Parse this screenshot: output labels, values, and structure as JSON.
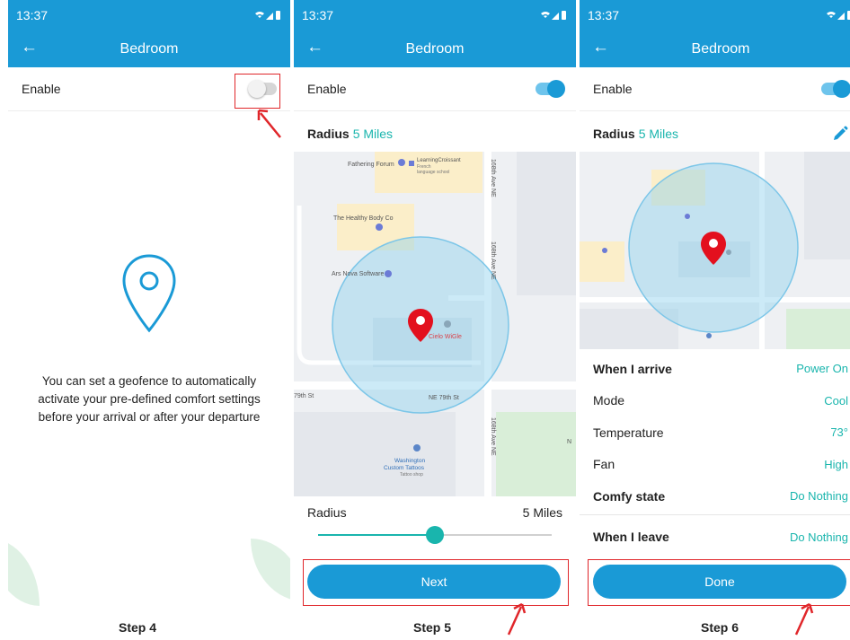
{
  "colors": {
    "primary": "#1a9ad6",
    "accent": "#19b5ad",
    "annotation": "#e0262a",
    "pin": "#e3101e"
  },
  "screens": [
    {
      "status_time": "13:37",
      "title": "Bedroom",
      "enable_label": "Enable",
      "enabled": false,
      "geofence_text": "You can set a geofence to automatically activate your pre-defined comfort settings before your arrival or after your departure",
      "step_label": "Step 4"
    },
    {
      "status_time": "13:37",
      "title": "Bedroom",
      "enable_label": "Enable",
      "enabled": true,
      "radius_label": "Radius",
      "radius_value": "5 Miles",
      "map_labels": {
        "fathering_forum": "Fathering Forum",
        "learning_croissant": "LearningCroissant",
        "learning_croissant_sub": "French",
        "learning_croissant_sub2": "language school",
        "healthy_body": "The Healthy Body Co",
        "ars_nova": "Ars Nova Software",
        "cielo": "Cielo WiGle",
        "street_168": "168th Ave NE",
        "street_79_left": "79th St",
        "street_79": "NE 79th St",
        "washington_tattoos": "Washington",
        "washington_tattoos_2": "Custom Tattoos",
        "washington_tattoos_3": "Tattoo shop",
        "n_label": "N"
      },
      "slider_label": "Radius",
      "slider_value": "5 Miles",
      "slider_level": 0.5,
      "next_label": "Next",
      "step_label": "Step 5"
    },
    {
      "status_time": "13:37",
      "title": "Bedroom",
      "enable_label": "Enable",
      "enabled": true,
      "radius_label": "Radius",
      "radius_value": "5 Miles",
      "edit_icon": "pencil-icon",
      "settings": [
        {
          "key": "When I arrive",
          "value": "Power On",
          "bold": true
        },
        {
          "key": "Mode",
          "value": "Cool",
          "bold": false
        },
        {
          "key": "Temperature",
          "value": "73°",
          "bold": false
        },
        {
          "key": "Fan",
          "value": "High",
          "bold": false
        },
        {
          "key": "Comfy state",
          "value": "Do Nothing",
          "bold": true
        }
      ],
      "leave": {
        "key": "When I leave",
        "value": "Do Nothing"
      },
      "done_label": "Done",
      "step_label": "Step 6"
    }
  ]
}
